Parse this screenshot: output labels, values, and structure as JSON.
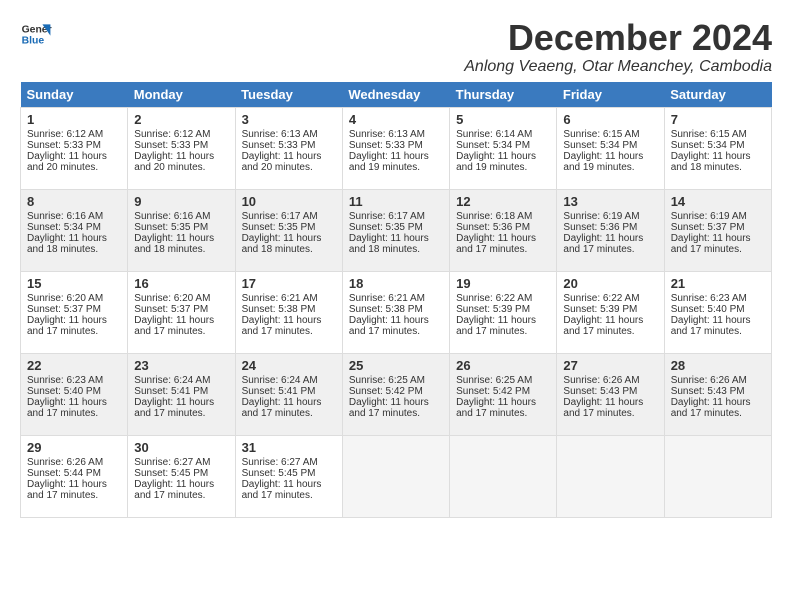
{
  "app": {
    "logo_line1": "General",
    "logo_line2": "Blue"
  },
  "header": {
    "month_title": "December 2024",
    "subtitle": "Anlong Veaeng, Otar Meanchey, Cambodia"
  },
  "days_of_week": [
    "Sunday",
    "Monday",
    "Tuesday",
    "Wednesday",
    "Thursday",
    "Friday",
    "Saturday"
  ],
  "weeks": [
    [
      {
        "day": "1",
        "info": "Sunrise: 6:12 AM\nSunset: 5:33 PM\nDaylight: 11 hours\nand 20 minutes."
      },
      {
        "day": "2",
        "info": "Sunrise: 6:12 AM\nSunset: 5:33 PM\nDaylight: 11 hours\nand 20 minutes."
      },
      {
        "day": "3",
        "info": "Sunrise: 6:13 AM\nSunset: 5:33 PM\nDaylight: 11 hours\nand 20 minutes."
      },
      {
        "day": "4",
        "info": "Sunrise: 6:13 AM\nSunset: 5:33 PM\nDaylight: 11 hours\nand 19 minutes."
      },
      {
        "day": "5",
        "info": "Sunrise: 6:14 AM\nSunset: 5:34 PM\nDaylight: 11 hours\nand 19 minutes."
      },
      {
        "day": "6",
        "info": "Sunrise: 6:15 AM\nSunset: 5:34 PM\nDaylight: 11 hours\nand 19 minutes."
      },
      {
        "day": "7",
        "info": "Sunrise: 6:15 AM\nSunset: 5:34 PM\nDaylight: 11 hours\nand 18 minutes."
      }
    ],
    [
      {
        "day": "8",
        "info": "Sunrise: 6:16 AM\nSunset: 5:34 PM\nDaylight: 11 hours\nand 18 minutes."
      },
      {
        "day": "9",
        "info": "Sunrise: 6:16 AM\nSunset: 5:35 PM\nDaylight: 11 hours\nand 18 minutes."
      },
      {
        "day": "10",
        "info": "Sunrise: 6:17 AM\nSunset: 5:35 PM\nDaylight: 11 hours\nand 18 minutes."
      },
      {
        "day": "11",
        "info": "Sunrise: 6:17 AM\nSunset: 5:35 PM\nDaylight: 11 hours\nand 18 minutes."
      },
      {
        "day": "12",
        "info": "Sunrise: 6:18 AM\nSunset: 5:36 PM\nDaylight: 11 hours\nand 17 minutes."
      },
      {
        "day": "13",
        "info": "Sunrise: 6:19 AM\nSunset: 5:36 PM\nDaylight: 11 hours\nand 17 minutes."
      },
      {
        "day": "14",
        "info": "Sunrise: 6:19 AM\nSunset: 5:37 PM\nDaylight: 11 hours\nand 17 minutes."
      }
    ],
    [
      {
        "day": "15",
        "info": "Sunrise: 6:20 AM\nSunset: 5:37 PM\nDaylight: 11 hours\nand 17 minutes."
      },
      {
        "day": "16",
        "info": "Sunrise: 6:20 AM\nSunset: 5:37 PM\nDaylight: 11 hours\nand 17 minutes."
      },
      {
        "day": "17",
        "info": "Sunrise: 6:21 AM\nSunset: 5:38 PM\nDaylight: 11 hours\nand 17 minutes."
      },
      {
        "day": "18",
        "info": "Sunrise: 6:21 AM\nSunset: 5:38 PM\nDaylight: 11 hours\nand 17 minutes."
      },
      {
        "day": "19",
        "info": "Sunrise: 6:22 AM\nSunset: 5:39 PM\nDaylight: 11 hours\nand 17 minutes."
      },
      {
        "day": "20",
        "info": "Sunrise: 6:22 AM\nSunset: 5:39 PM\nDaylight: 11 hours\nand 17 minutes."
      },
      {
        "day": "21",
        "info": "Sunrise: 6:23 AM\nSunset: 5:40 PM\nDaylight: 11 hours\nand 17 minutes."
      }
    ],
    [
      {
        "day": "22",
        "info": "Sunrise: 6:23 AM\nSunset: 5:40 PM\nDaylight: 11 hours\nand 17 minutes."
      },
      {
        "day": "23",
        "info": "Sunrise: 6:24 AM\nSunset: 5:41 PM\nDaylight: 11 hours\nand 17 minutes."
      },
      {
        "day": "24",
        "info": "Sunrise: 6:24 AM\nSunset: 5:41 PM\nDaylight: 11 hours\nand 17 minutes."
      },
      {
        "day": "25",
        "info": "Sunrise: 6:25 AM\nSunset: 5:42 PM\nDaylight: 11 hours\nand 17 minutes."
      },
      {
        "day": "26",
        "info": "Sunrise: 6:25 AM\nSunset: 5:42 PM\nDaylight: 11 hours\nand 17 minutes."
      },
      {
        "day": "27",
        "info": "Sunrise: 6:26 AM\nSunset: 5:43 PM\nDaylight: 11 hours\nand 17 minutes."
      },
      {
        "day": "28",
        "info": "Sunrise: 6:26 AM\nSunset: 5:43 PM\nDaylight: 11 hours\nand 17 minutes."
      }
    ],
    [
      {
        "day": "29",
        "info": "Sunrise: 6:26 AM\nSunset: 5:44 PM\nDaylight: 11 hours\nand 17 minutes."
      },
      {
        "day": "30",
        "info": "Sunrise: 6:27 AM\nSunset: 5:45 PM\nDaylight: 11 hours\nand 17 minutes."
      },
      {
        "day": "31",
        "info": "Sunrise: 6:27 AM\nSunset: 5:45 PM\nDaylight: 11 hours\nand 17 minutes."
      },
      {
        "day": "",
        "info": ""
      },
      {
        "day": "",
        "info": ""
      },
      {
        "day": "",
        "info": ""
      },
      {
        "day": "",
        "info": ""
      }
    ]
  ]
}
